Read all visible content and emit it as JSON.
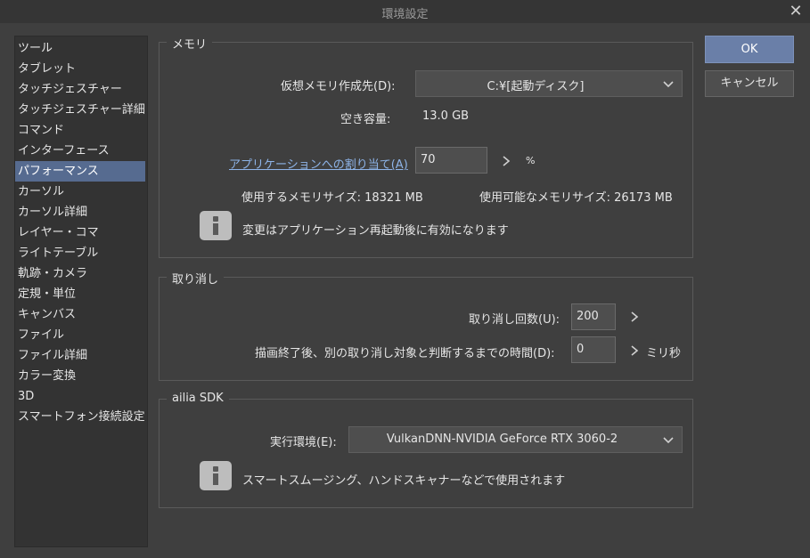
{
  "window": {
    "title": "環境設定"
  },
  "sidebar": {
    "items": [
      {
        "label": "ツール"
      },
      {
        "label": "タブレット"
      },
      {
        "label": "タッチジェスチャー"
      },
      {
        "label": "タッチジェスチャー詳細"
      },
      {
        "label": "コマンド"
      },
      {
        "label": "インターフェース"
      },
      {
        "label": "パフォーマンス",
        "selected": true
      },
      {
        "label": "カーソル"
      },
      {
        "label": "カーソル詳細"
      },
      {
        "label": "レイヤー・コマ"
      },
      {
        "label": "ライトテーブル"
      },
      {
        "label": "軌跡・カメラ"
      },
      {
        "label": "定規・単位"
      },
      {
        "label": "キャンバス"
      },
      {
        "label": "ファイル"
      },
      {
        "label": "ファイル詳細"
      },
      {
        "label": "カラー変換"
      },
      {
        "label": "3D"
      },
      {
        "label": "スマートフォン接続設定"
      }
    ]
  },
  "memory": {
    "group_label": "メモリ",
    "virtual_memory_label": "仮想メモリ作成先(D):",
    "virtual_memory_value": "C:¥[起動ディスク]",
    "free_space_label": "空き容量:",
    "free_space_value": "13.0 GB",
    "allocation_label": "アプリケーションへの割り当て(A)",
    "allocation_value": "70",
    "allocation_unit": "%",
    "used_memory": "使用するメモリサイズ: 18321 MB",
    "available_memory": "使用可能なメモリサイズ: 26173 MB",
    "info_text": "変更はアプリケーション再起動後に有効になります"
  },
  "undo": {
    "group_label": "取り消し",
    "count_label": "取り消し回数(U):",
    "count_value": "200",
    "time_label": "描画終了後、別の取り消し対象と判断するまでの時間(D):",
    "time_value": "0",
    "time_unit": "ミリ秒"
  },
  "ailia": {
    "group_label": "ailia SDK",
    "env_label": "実行環境(E):",
    "env_value": "VulkanDNN-NVIDIA GeForce RTX 3060-2",
    "info_text": "スマートスムージング、ハンドスキャナーなどで使用されます"
  },
  "buttons": {
    "ok": "OK",
    "cancel": "キャンセル"
  },
  "colors": {
    "selection": "#566b90",
    "ok_button": "#6a7fa8",
    "link": "#8eb4e8",
    "background": "#3f3f3f"
  }
}
